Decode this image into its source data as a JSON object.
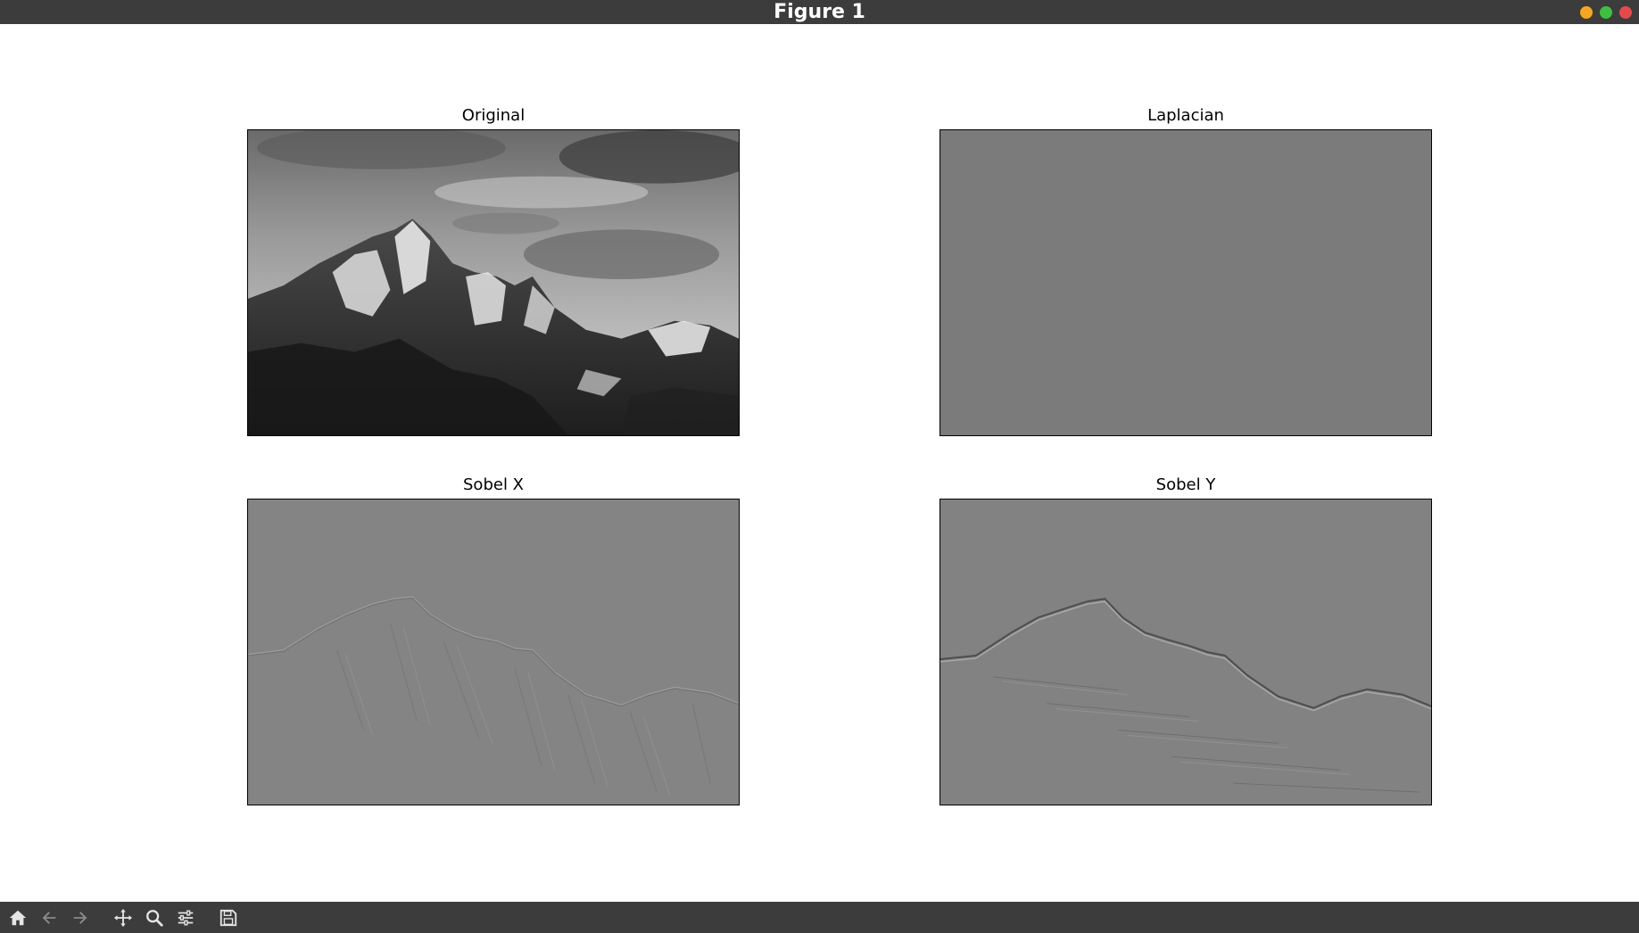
{
  "window": {
    "title": "Figure 1",
    "controls": [
      "minimize",
      "maximize",
      "close"
    ],
    "colors": {
      "titlebar": "#3c3c3c",
      "minimize": "#f5a623",
      "maximize": "#3fbf3f",
      "close": "#e34b4b"
    }
  },
  "figure": {
    "subplots": [
      {
        "title": "Original",
        "image": "grayscale-mountain-photo"
      },
      {
        "title": "Laplacian",
        "image": "uniform-gray-laplacian-output"
      },
      {
        "title": "Sobel X",
        "image": "gray-embossed-edges-horizontal-gradient"
      },
      {
        "title": "Sobel Y",
        "image": "gray-embossed-edges-vertical-gradient"
      }
    ]
  },
  "toolbar": {
    "tools": [
      {
        "name": "home-icon"
      },
      {
        "name": "back-arrow-icon"
      },
      {
        "name": "forward-arrow-icon"
      },
      {
        "name": "pan-move-icon"
      },
      {
        "name": "zoom-magnifier-icon"
      },
      {
        "name": "configure-subplots-icon"
      },
      {
        "name": "save-floppy-icon"
      }
    ]
  }
}
